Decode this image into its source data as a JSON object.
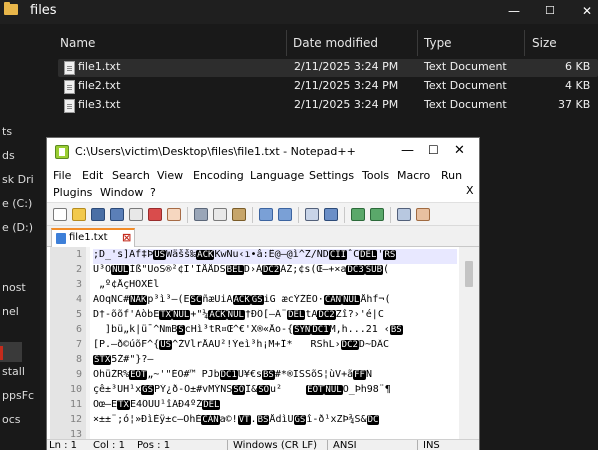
{
  "explorer": {
    "title": "files",
    "window_controls": {
      "minimize": "—",
      "maximize": "☐",
      "close": "✕"
    },
    "nav_items": [
      "ts",
      "ds",
      "sk Dri",
      "e (C:)",
      "e (D:)",
      "nost",
      "nel",
      "",
      "stall",
      "ppsFc",
      "ocs"
    ],
    "columns": {
      "name": "Name",
      "date": "Date modified",
      "type": "Type",
      "size": "Size"
    },
    "files": [
      {
        "name": "file1.txt",
        "date": "2/11/2025 3:24 PM",
        "type": "Text Document",
        "size": "6 KB"
      },
      {
        "name": "file2.txt",
        "date": "2/11/2025 3:24 PM",
        "type": "Text Document",
        "size": "4 KB"
      },
      {
        "name": "file3.txt",
        "date": "2/11/2025 3:24 PM",
        "type": "Text Document",
        "size": "37 KB"
      }
    ]
  },
  "notepad": {
    "title": "C:\\Users\\victim\\Desktop\\files\\file1.txt - Notepad++",
    "window_controls": {
      "minimize": "—",
      "maximize": "☐",
      "close": "✕"
    },
    "menu_row1": [
      "File",
      "Edit",
      "Search",
      "View",
      "Encoding",
      "Language",
      "Settings",
      "Tools",
      "Macro",
      "Run"
    ],
    "menu_row2": [
      "Plugins",
      "Window",
      "?"
    ],
    "menu_close": "X",
    "toolbar_icons": [
      "new-file",
      "open-file",
      "save",
      "save-all",
      "close",
      "close-all",
      "print",
      "cut",
      "copy",
      "paste",
      "undo",
      "redo",
      "find",
      "replace",
      "zoom-in",
      "zoom-out",
      "sync-scroll",
      "word-wrap"
    ],
    "tab": {
      "label": "file1.txt",
      "close": "⊠"
    },
    "line_numbers": [
      "1",
      "2",
      "3",
      "4",
      "5",
      "6",
      "7",
      "8",
      "9",
      "10",
      "11",
      "12",
      "13"
    ],
    "lines": [
      [
        {
          "t": ";D_'s]Af‡Þ"
        },
        {
          "c": "US"
        },
        {
          "t": "Wäšš‰"
        },
        {
          "c": "ACK"
        },
        {
          "t": "KwNu‹ı•â:Ê@—@ì^Z/ÑD"
        },
        {
          "c": "CII"
        },
        {
          "t": "ˆC"
        },
        {
          "c": "DEL"
        },
        {
          "t": "'"
        },
        {
          "c": "RS"
        }
      ],
      [
        {
          "t": "U³O"
        },
        {
          "c": "NUL"
        },
        {
          "t": "Ìß\"UoS®²¢I'ÎÅÅDŠ"
        },
        {
          "c": "BEL"
        },
        {
          "t": "D›À"
        },
        {
          "c": "DC2"
        },
        {
          "t": "ÀŽ;¢s(Œ—+×a"
        },
        {
          "c": "DC3"
        },
        {
          "c": "SUB"
        },
        {
          "t": "("
        }
      ],
      [
        {
          "t": " „º¢ÅçHÕXÈl"
        }
      ],
      [
        {
          "t": "ÄOqNC#"
        },
        {
          "c": "NAK"
        },
        {
          "t": "p³ì³–(E"
        },
        {
          "c": "SC"
        },
        {
          "t": "ñæÜiA"
        },
        {
          "c": "ACK"
        },
        {
          "c": "GS"
        },
        {
          "t": "iG æcÝŽÉÓ·"
        },
        {
          "c": "CAN"
        },
        {
          "c": "NUL"
        },
        {
          "t": "Åhf¬("
        }
      ],
      [
        {
          "t": "D†-õõf'ÀòbE"
        },
        {
          "c": "TX"
        },
        {
          "c": "NUL"
        },
        {
          "t": "+\"¼"
        },
        {
          "c": "ACK"
        },
        {
          "c": "NUL"
        },
        {
          "t": "†ÐÕ[–Ã¨"
        },
        {
          "c": "DEL"
        },
        {
          "t": "tÄ"
        },
        {
          "c": "DC2"
        },
        {
          "t": "Zî?›'é|C"
        }
      ],
      [
        {
          "t": "  ]bü„k|ü¯^ÑmB"
        },
        {
          "c": "S"
        },
        {
          "t": "cHì³tR¤Œ^€'X®«Åo-{"
        },
        {
          "c": "SYN"
        },
        {
          "c": "DC1"
        },
        {
          "t": "M,h...21 ‹"
        },
        {
          "c": "BS"
        }
      ],
      [
        {
          "t": "[P.—ð©úõF^{"
        },
        {
          "c": "US"
        },
        {
          "t": "^ŽVlrÅÄÜ²!Ýeì³h¡M+Î*   RS"
        },
        {
          "t": "hL›"
        },
        {
          "c": "DC2"
        },
        {
          "t": "D~DÂC"
        }
      ],
      [
        {
          "c": "STX"
        },
        {
          "t": "5Ž#\"}?–"
        }
      ],
      [
        {
          "t": "ÖhüŽR%"
        },
        {
          "c": "EOT"
        },
        {
          "t": "„~'\"ÉÖ#™ PJb"
        },
        {
          "c": "DC1"
        },
        {
          "t": "Ü¥€s"
        },
        {
          "c": "BS"
        },
        {
          "t": "#*®ÏŠSõŠ¦ùV+ã"
        },
        {
          "c": "FF"
        },
        {
          "t": "Ñ"
        }
      ],
      [
        {
          "t": "çê±³ÙH¹x"
        },
        {
          "c": "GS"
        },
        {
          "t": "PÝ¿ð-Õ±#vMÝÑS"
        },
        {
          "c": "SO"
        },
        {
          "t": "Î&"
        },
        {
          "c": "SO"
        },
        {
          "t": "u²    "
        },
        {
          "c": "EOT"
        },
        {
          "c": "NUL"
        },
        {
          "t": "O_Þh98¨¶"
        }
      ],
      [
        {
          "t": "Óœ—E"
        },
        {
          "c": "TX"
        },
        {
          "t": "E4ÕÛÙ¹îÃÐ4ºŽ"
        },
        {
          "c": "DEL"
        }
      ],
      [
        {
          "t": "×±±¨;ó¦»ÐìÈÿ±c–ÓhÈ"
        },
        {
          "c": "CAN"
        },
        {
          "t": "a©!"
        },
        {
          "c": "VT"
        },
        {
          "t": "."
        },
        {
          "c": "BS"
        },
        {
          "t": "ÅdìU"
        },
        {
          "c": "GS"
        },
        {
          "t": "î-ð¹xZÞ¾Š&"
        },
        {
          "c": "DC"
        }
      ],
      [
        {
          "t": ""
        }
      ]
    ],
    "status": {
      "length": "Ln : 1",
      "col": "Col : 1",
      "pos": "Pos : 1",
      "eol": "Windows (CR LF)",
      "encoding": "ANSI",
      "mode": "INS"
    }
  }
}
